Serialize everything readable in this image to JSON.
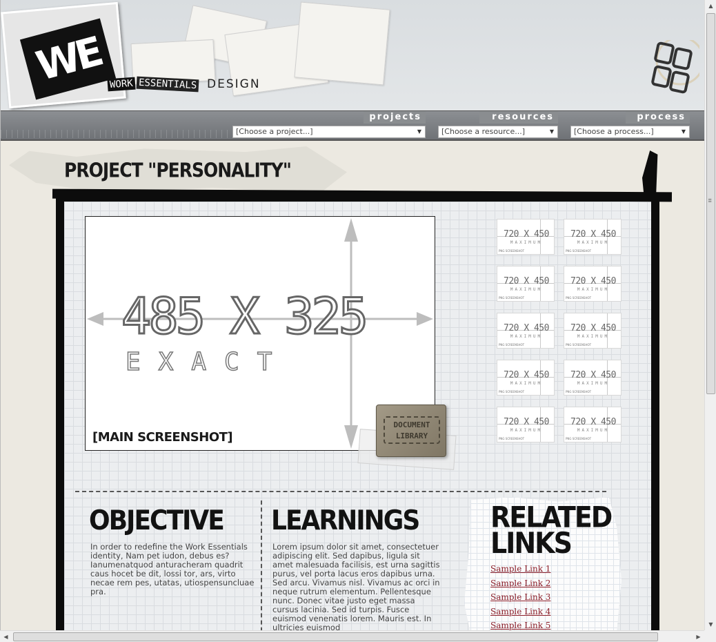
{
  "header": {
    "logo_text": "WE",
    "wordmark_tiles": [
      "WORK",
      "ESSENTIALS"
    ],
    "wordmark_suffix": "DESIGN"
  },
  "nav": [
    {
      "label": "projects",
      "selected": "[Choose a project...]"
    },
    {
      "label": "resources",
      "selected": "[Choose a resource...]"
    },
    {
      "label": "process",
      "selected": "[Choose a process...]"
    }
  ],
  "page": {
    "title": "PROJECT \"PERSONALITY\""
  },
  "main_screenshot": {
    "dimension_text": "485 X 325",
    "exact_text": "EXACT",
    "caption": "[MAIN SCREENSHOT]"
  },
  "document_library": {
    "line1": "DOCUMENT",
    "line2": "LIBRARY"
  },
  "thumbnails": {
    "size_text": "720 X 450",
    "sub_text": "MAXIMUM",
    "corner_text": "PNG SCREENSHOT",
    "count": 10
  },
  "objective": {
    "title": "OBJECTIVE",
    "body": "In order to redefine the Work Essentials identity, Nam pet iudon, debus es? Ianumenatquod anturacheram quadrit caus hocet be dit, lossi tor, ars, virto necae rem pes, utatas, utiospensuncluae pra."
  },
  "learnings": {
    "title": "LEARNINGS",
    "body": "Lorem ipsum dolor sit amet, consectetuer adipiscing elit. Sed dapibus, ligula sit amet malesuada facilisis, est urna sagittis purus, vel porta lacus eros dapibus urna. Sed arcu. Vivamus nisl. Vivamus ac orci in neque rutrum elementum. Pellentesque nunc. Donec vitae justo eget massa cursus lacinia. Sed id turpis. Fusce euismod venenatis lorem. Mauris est. In ultricies euismod"
  },
  "related": {
    "title_line1": "RELATED",
    "title_line2": "LINKS",
    "links": [
      "Sample Link 1",
      "Sample Link 2",
      "Sample Link 3",
      "Sample Link 4",
      "Sample Link 5"
    ]
  },
  "colors": {
    "frame": "#0c0c0c",
    "link": "#8b1f2a",
    "navbar": "#7d8084",
    "background": "#ece9e1"
  }
}
